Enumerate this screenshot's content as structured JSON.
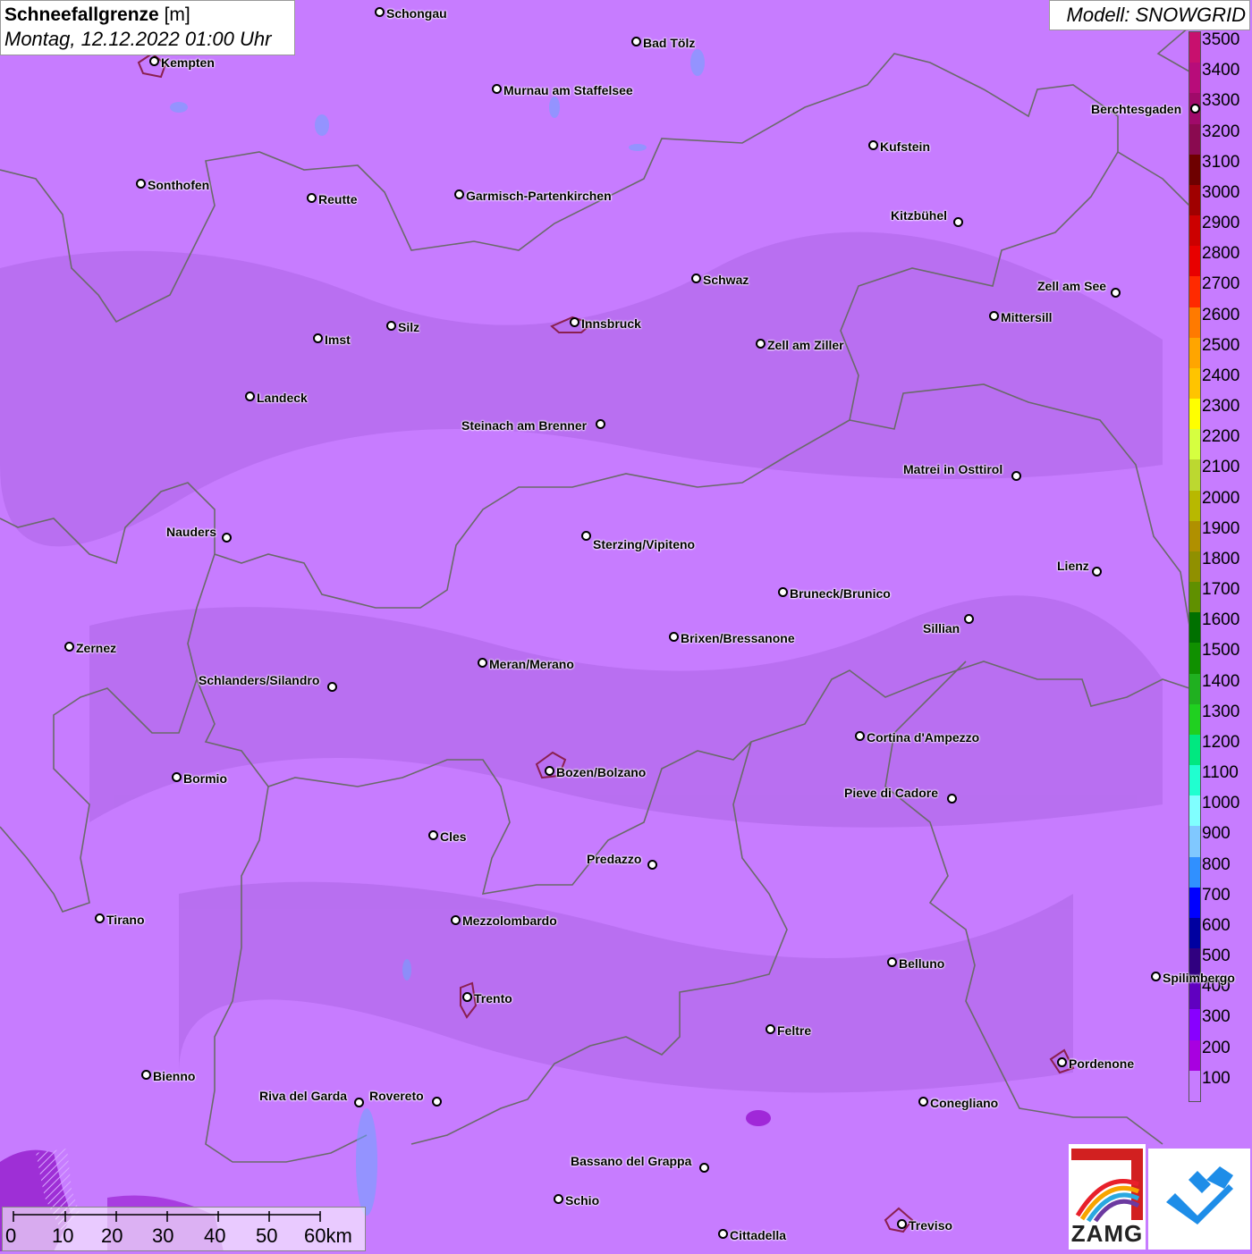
{
  "title": {
    "variable": "Schneefallgrenze",
    "unit": "[m]",
    "datetime": "Montag, 12.12.2022 01:00 Uhr"
  },
  "model": "Modell: SNOWGRID",
  "legend": {
    "labels": [
      "3500",
      "3400",
      "3300",
      "3200",
      "3100",
      "3000",
      "2900",
      "2800",
      "2700",
      "2600",
      "2500",
      "2400",
      "2300",
      "2200",
      "2100",
      "2000",
      "1900",
      "1800",
      "1700",
      "1600",
      "1500",
      "1400",
      "1300",
      "1200",
      "1100",
      "1000",
      "900",
      "800",
      "700",
      "600",
      "500",
      "400",
      "300",
      "200",
      "100"
    ],
    "colors": [
      "#c8106e",
      "#b80c7a",
      "#a00a6a",
      "#8a0a50",
      "#6e0000",
      "#a00000",
      "#cc0000",
      "#e80000",
      "#ff2a00",
      "#ff7a00",
      "#ffa500",
      "#ffc400",
      "#ffff00",
      "#d6ff40",
      "#bcd830",
      "#b8b800",
      "#b09000",
      "#909000",
      "#609000",
      "#007000",
      "#109000",
      "#20b020",
      "#20d020",
      "#00e880",
      "#20ffd0",
      "#80ffff",
      "#80c8ff",
      "#3090ff",
      "#0000ff",
      "#0000a0",
      "#300080",
      "#6000c0",
      "#8800ff",
      "#a800e0",
      "#c77cff"
    ]
  },
  "cities": [
    {
      "name": "Schongau"
    },
    {
      "name": "Bad Tölz"
    },
    {
      "name": "Kempten"
    },
    {
      "name": "Murnau am Staffelsee"
    },
    {
      "name": "Berchtesgaden"
    },
    {
      "name": "Kufstein"
    },
    {
      "name": "Sonthofen"
    },
    {
      "name": "Reutte"
    },
    {
      "name": "Garmisch-Partenkirchen"
    },
    {
      "name": "Kitzbühel"
    },
    {
      "name": "Schwaz"
    },
    {
      "name": "Zell am See"
    },
    {
      "name": "Innsbruck"
    },
    {
      "name": "Mittersill"
    },
    {
      "name": "Imst"
    },
    {
      "name": "Silz"
    },
    {
      "name": "Zell am Ziller"
    },
    {
      "name": "Landeck"
    },
    {
      "name": "Steinach am Brenner"
    },
    {
      "name": "Matrei in Osttirol"
    },
    {
      "name": "Nauders"
    },
    {
      "name": "Sterzing/Vipiteno"
    },
    {
      "name": "Lienz"
    },
    {
      "name": "Bruneck/Brunico"
    },
    {
      "name": "Sillian"
    },
    {
      "name": "Zernez"
    },
    {
      "name": "Brixen/Bressanone"
    },
    {
      "name": "Meran/Merano"
    },
    {
      "name": "Schlanders/Silandro"
    },
    {
      "name": "Cortina d'Ampezzo"
    },
    {
      "name": "Bozen/Bolzano"
    },
    {
      "name": "Bormio"
    },
    {
      "name": "Pieve di Cadore"
    },
    {
      "name": "Cles"
    },
    {
      "name": "Predazzo"
    },
    {
      "name": "Tirano"
    },
    {
      "name": "Mezzolombardo"
    },
    {
      "name": "Belluno"
    },
    {
      "name": "Spilimbergo"
    },
    {
      "name": "Trento"
    },
    {
      "name": "Feltre"
    },
    {
      "name": "Pordenone"
    },
    {
      "name": "Bienno"
    },
    {
      "name": "Riva del Garda"
    },
    {
      "name": "Rovereto"
    },
    {
      "name": "Conegliano"
    },
    {
      "name": "Bassano del Grappa"
    },
    {
      "name": "Schio"
    },
    {
      "name": "Treviso"
    },
    {
      "name": "Cittadella"
    }
  ],
  "scale": {
    "ticks": [
      "0",
      "10",
      "20",
      "30",
      "40",
      "50",
      "60km"
    ]
  },
  "logos": {
    "zamg": "ZAMG"
  }
}
